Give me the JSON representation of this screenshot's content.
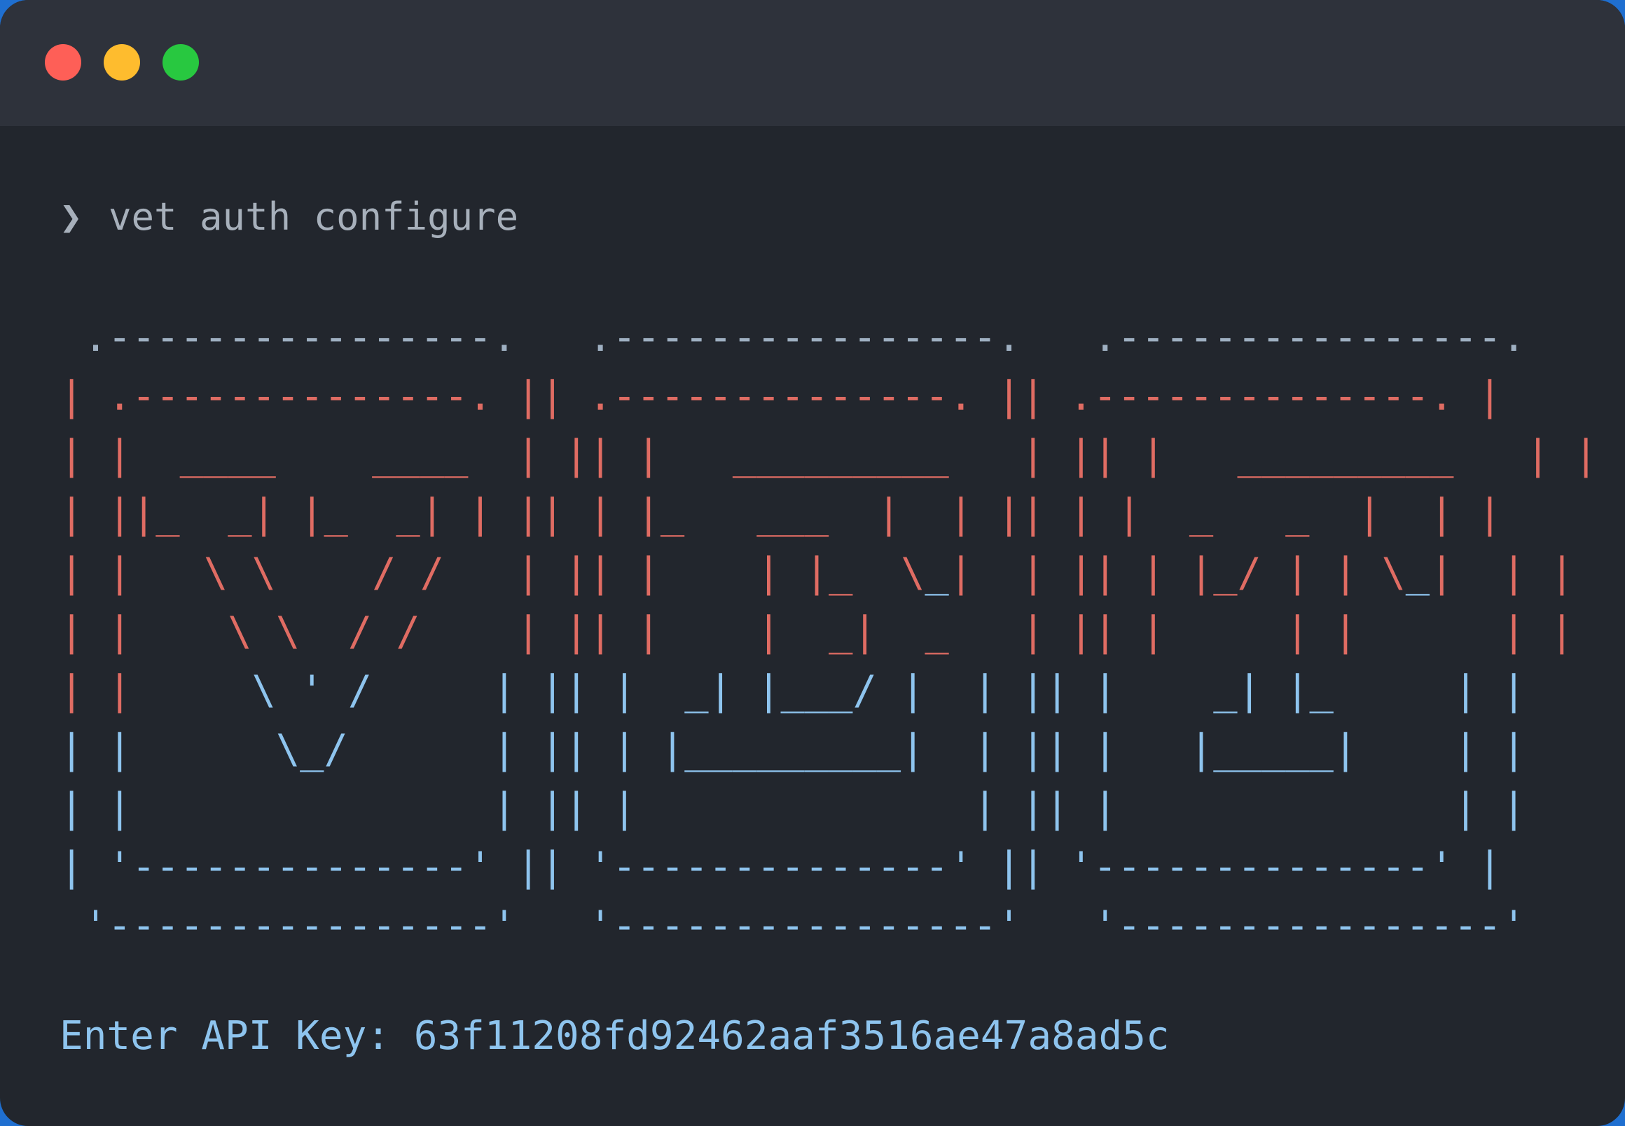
{
  "window": {
    "background": "#22262d",
    "titlebar_color": "#2e323b",
    "buttons": {
      "close_color": "#fe5f57",
      "minimize_color": "#febc2e",
      "maximize_color": "#28c840"
    }
  },
  "terminal": {
    "prompt_symbol": "❯",
    "command": "vet auth configure",
    "api_label": "Enter API Key:",
    "api_key": "63f11208fd92462aaf3516ae47a8ad5c",
    "colors": {
      "prompt_text": "#a7b0bb",
      "banner_red": "#e06c63",
      "banner_blue": "#8ec4ee",
      "banner_frame": "#9fb0c2"
    }
  },
  "banner": {
    "rows": [
      [
        {
          "t": " .----------------.   .----------------.   .----------------. ",
          "c": "n"
        }
      ],
      [
        {
          "t": "| .--------------. || .--------------. || .--------------. |",
          "c": "r"
        }
      ],
      [
        {
          "t": "| |  ____    ____  | || |   _________   | || |   _________   | |",
          "c": "r"
        }
      ],
      [
        {
          "t": "| ||_  _| |_  _| | || | |_   ___  |  | || | |  _   _  |  | |",
          "c": "r"
        }
      ],
      [
        {
          "t": "| |   \\ \\    / /   | || |    | |_  \\",
          "c": "r"
        },
        {
          "t": "_",
          "c": "b"
        },
        {
          "t": "|  | || | |_/ | | \\",
          "c": "r"
        },
        {
          "t": "_",
          "c": "b"
        },
        {
          "t": "|  | |",
          "c": "r"
        }
      ],
      [
        {
          "t": "| |    \\ \\  / /    | || |    |  _|  _   | || |     | |      | |",
          "c": "r"
        }
      ],
      [
        {
          "t": "| |",
          "c": "r"
        },
        {
          "t": "     \\ ' /     | || |  _| |___/ |  | || |    _| |_     | |",
          "c": "b"
        }
      ],
      [
        {
          "t": "| |      \\_/      | || | |_________|  | || |   |_____|    | |",
          "c": "b"
        }
      ],
      [
        {
          "t": "| |               | || |              | || |              | |",
          "c": "b"
        }
      ],
      [
        {
          "t": "| '--------------' || '--------------' || '--------------' |",
          "c": "b"
        }
      ],
      [
        {
          "t": " '----------------'   '----------------'   '----------------' ",
          "c": "b"
        }
      ]
    ]
  }
}
